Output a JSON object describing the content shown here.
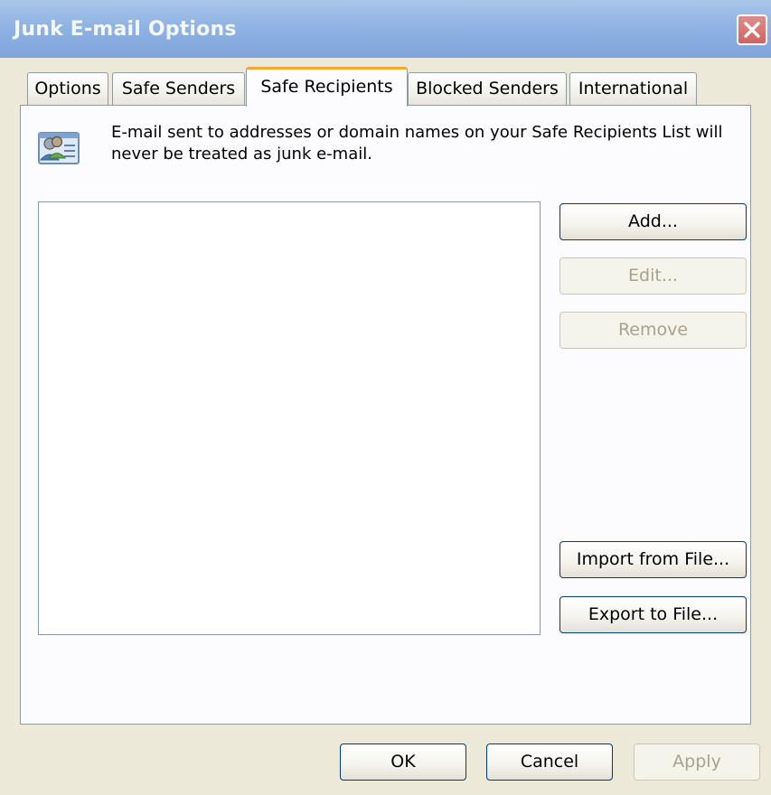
{
  "window": {
    "title": "Junk E-mail Options"
  },
  "tabs": [
    {
      "label": "Options",
      "active": false
    },
    {
      "label": "Safe Senders",
      "active": false
    },
    {
      "label": "Safe Recipients",
      "active": true
    },
    {
      "label": "Blocked Senders",
      "active": false
    },
    {
      "label": "International",
      "active": false
    }
  ],
  "panel": {
    "icon": "address-book-people-icon",
    "description": "E-mail sent to addresses or domain names on your Safe Recipients List will never be treated as junk e-mail.",
    "list_items": []
  },
  "side_buttons": {
    "add": "Add...",
    "edit": "Edit...",
    "remove": "Remove",
    "import": "Import from File...",
    "export": "Export to File..."
  },
  "footer_buttons": {
    "ok": "OK",
    "cancel": "Cancel",
    "apply": "Apply"
  },
  "colors": {
    "accent_tab": "#f4a62d",
    "button_border": "#003c74",
    "close_red": "#d46262"
  }
}
